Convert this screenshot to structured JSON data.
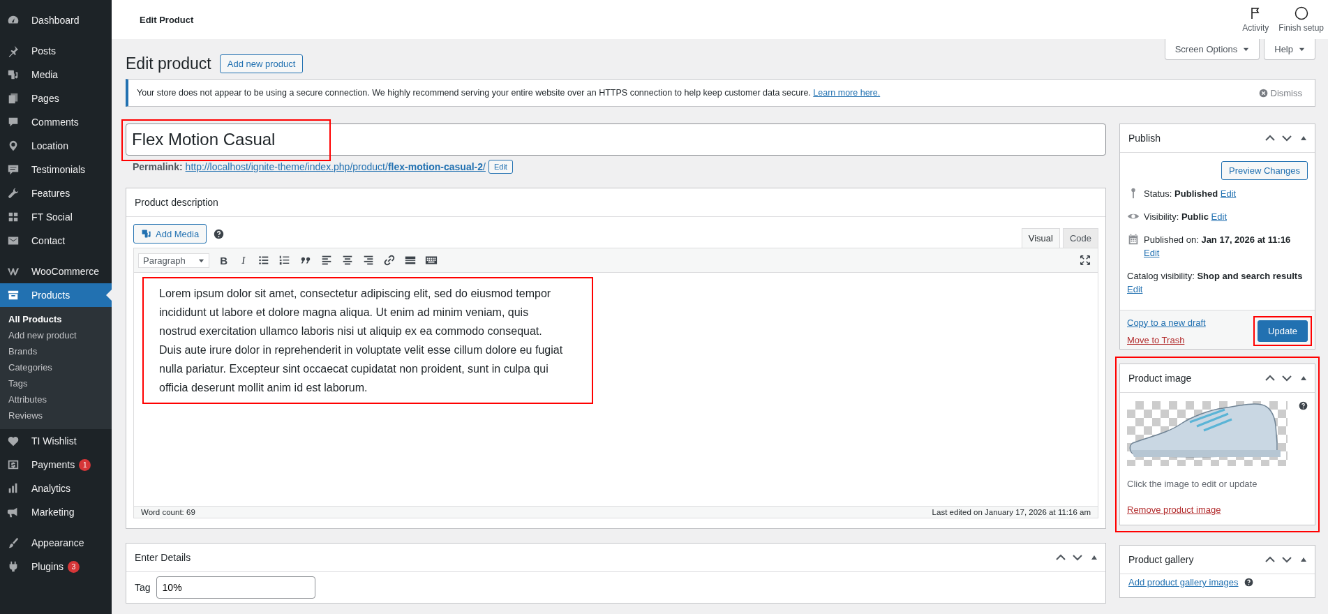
{
  "top_bar": {
    "title": "Edit Product",
    "actions": [
      {
        "label": "Activity"
      },
      {
        "label": "Finish setup"
      }
    ]
  },
  "sidebar": {
    "groups": [
      {
        "items": [
          {
            "label": "Dashboard",
            "selected": false
          }
        ]
      },
      {
        "items": [
          {
            "label": "Posts",
            "selected": false
          },
          {
            "label": "Media",
            "selected": false
          },
          {
            "label": "Pages",
            "selected": false
          },
          {
            "label": "Comments",
            "selected": false
          },
          {
            "label": "Location",
            "selected": false
          },
          {
            "label": "Testimonials",
            "selected": false
          },
          {
            "label": "Features",
            "selected": false
          },
          {
            "label": "FT Social",
            "selected": false
          },
          {
            "label": "Contact",
            "selected": false
          }
        ]
      },
      {
        "items": [
          {
            "label": "WooCommerce",
            "selected": false
          },
          {
            "label": "Products",
            "selected": true,
            "children": [
              {
                "label": "All Products",
                "selected": true
              },
              {
                "label": "Add new product",
                "selected": false
              },
              {
                "label": "Brands",
                "selected": false
              },
              {
                "label": "Categories",
                "selected": false
              },
              {
                "label": "Tags",
                "selected": false
              },
              {
                "label": "Attributes",
                "selected": false
              },
              {
                "label": "Reviews",
                "selected": false
              }
            ]
          },
          {
            "label": "TI Wishlist",
            "selected": false
          },
          {
            "label": "Payments",
            "selected": false,
            "badge": "1"
          },
          {
            "label": "Analytics",
            "selected": false
          },
          {
            "label": "Marketing",
            "selected": false
          }
        ]
      },
      {
        "items": [
          {
            "label": "Appearance",
            "selected": false
          },
          {
            "label": "Plugins",
            "selected": false,
            "badge": "3"
          }
        ]
      }
    ]
  },
  "screen_tabs": [
    {
      "label": "Screen Options"
    },
    {
      "label": "Help"
    }
  ],
  "heading": "Edit product",
  "add_new_button": "Add new product",
  "notice": {
    "text": "Your store does not appear to be using a secure connection. We highly recommend serving your entire website over an HTTPS connection to help keep customer data secure.",
    "link": "Learn more here.",
    "dismiss": "Dismiss"
  },
  "title_field": {
    "value": "Flex Motion Casual",
    "highlighted": true
  },
  "permalink": {
    "label": "Permalink:",
    "url": "http://localhost/ignite-theme/index.php/product/**flex-motion-casual-2**/",
    "edit_button": "Edit"
  },
  "description": {
    "title": "Product description",
    "add_media": "Add Media",
    "tabs": [
      {
        "label": "Visual",
        "selected": true
      },
      {
        "label": "Code",
        "selected": false
      }
    ],
    "toolbar": {
      "format": "Paragraph",
      "bold": "B",
      "italic": "I"
    },
    "content": "Lorem ipsum dolor sit amet, consectetur adipiscing elit, sed do eiusmod tempor incididunt ut labore et dolore magna aliqua. Ut enim ad minim veniam, quis nostrud exercitation ullamco laboris nisi ut aliquip ex ea commodo consequat. Duis aute irure dolor in reprehenderit in voluptate velit esse cillum dolore eu fugiat nulla pariatur. Excepteur sint occaecat cupidatat non proident, sunt in culpa qui officia deserunt mollit anim id est laborum.",
    "highlighted": true,
    "word_count": "Word count: 69",
    "last_edited": "Last edited on January 17, 2026 at 11:16 am"
  },
  "enter_details": {
    "title": "Enter Details",
    "fields": [
      {
        "label": "Tag",
        "value": "10%"
      }
    ]
  },
  "publish": {
    "title": "Publish",
    "preview_button": "Preview Changes",
    "rows": [
      {
        "label": "Status:",
        "value": "Published",
        "link": "Edit"
      },
      {
        "label": "Visibility:",
        "value": "Public",
        "link": "Edit"
      },
      {
        "label": "Published on:",
        "value": "Jan 17, 2026 at 11:16",
        "link": "Edit"
      },
      {
        "label": "Catalog visibility:",
        "value": "Shop and search results",
        "link": "Edit"
      }
    ],
    "copy_link": "Copy to a new draft",
    "trash_link": "Move to Trash",
    "update_button": {
      "label": "Update",
      "highlighted": true
    }
  },
  "product_image": {
    "title": "Product image",
    "hint": "Click the image to edit or update",
    "remove_link": "Remove product image",
    "highlighted": true
  },
  "product_gallery": {
    "title": "Product gallery",
    "add_link": "Add product gallery images"
  }
}
